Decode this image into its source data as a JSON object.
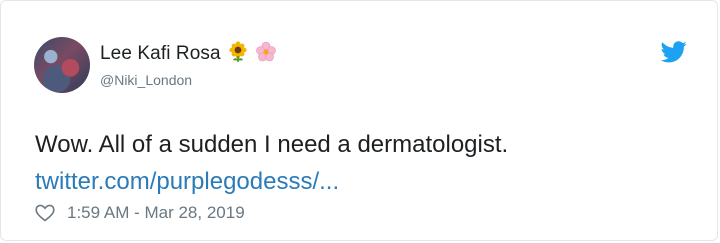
{
  "author": {
    "display_name": "Lee Kafi Rosa",
    "handle": "@Niki_London",
    "emojis": [
      "sunflower-icon",
      "blossom-icon"
    ]
  },
  "tweet": {
    "text": "Wow. All of a sudden I need a dermatologist.",
    "link": "twitter.com/purplegodesss/...",
    "timestamp": "1:59 AM - Mar 28, 2019"
  },
  "colors": {
    "link": "#2b7bb9",
    "twitter_blue": "#1da1f2",
    "muted": "#697882"
  },
  "icons": {
    "logo": "twitter-bird-icon",
    "like": "heart-icon"
  }
}
